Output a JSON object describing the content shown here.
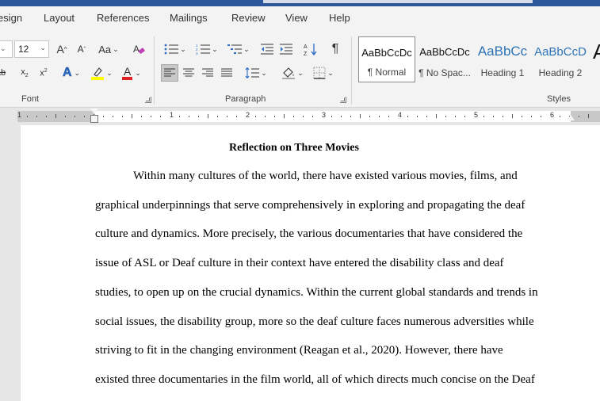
{
  "ribbon": {
    "tabs": [
      "esign",
      "Layout",
      "References",
      "Mailings",
      "Review",
      "View",
      "Help"
    ],
    "font": {
      "size_value": "12",
      "group_label": "Font",
      "case_label": "Aa",
      "grow_label": "A",
      "shrink_label": "A",
      "text_effects_label": "A",
      "font_color_label": "A",
      "font_color": "#e02020",
      "highlight_color": "#ffff00"
    },
    "paragraph": {
      "group_label": "Paragraph",
      "pilcrow": "¶"
    },
    "styles": {
      "group_label": "Styles",
      "items": [
        {
          "preview": "AaBbCcDc",
          "name": "¶ Normal"
        },
        {
          "preview": "AaBbCcDc",
          "name": "¶ No Spac..."
        },
        {
          "preview": "AaBbCc",
          "name": "Heading 1"
        },
        {
          "preview": "AaBbCcD",
          "name": "Heading 2"
        }
      ],
      "more_preview": "A"
    }
  },
  "ruler": {
    "numbers": [
      "1",
      "1",
      "2",
      "3",
      "4",
      "5",
      "6"
    ]
  },
  "document": {
    "title": "Reflection on Three Movies",
    "lines": [
      "Within many cultures of the world, there have existed various movies, films, and",
      "graphical underpinnings that serve comprehensively in exploring and propagating the deaf",
      "culture and dynamics. More precisely, the various documentaries that have considered the",
      "issue of ASL or Deaf culture in their context have entered the disability class and deaf",
      "studies, to open up on the crucial dynamics. Within the current global standards and trends in",
      "social issues, the disability group, more so the deaf culture faces numerous adversities while",
      "striving to fit in the changing environment (Reagan et al., 2020).  However, there have",
      "existed three documentaries in the film world, all of which directs much concise on the Deaf"
    ]
  },
  "colors": {
    "title_bar": "#2b579a",
    "heading_blue": "#2e74b5"
  }
}
